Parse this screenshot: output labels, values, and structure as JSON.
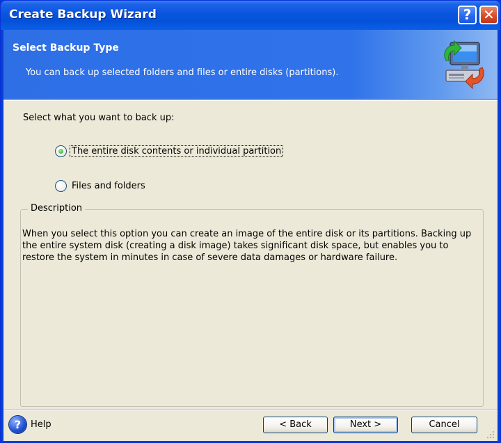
{
  "window": {
    "title": "Create Backup Wizard",
    "help_glyph": "?",
    "close_glyph": "✕"
  },
  "header": {
    "title": "Select Backup Type",
    "subtitle": "You can back up selected folders and files or entire disks (partitions).",
    "icon": "computer-backup-icon"
  },
  "main": {
    "prompt": "Select what you want to back up:",
    "options": [
      {
        "label": "The entire disk contents or individual partition",
        "selected": true
      },
      {
        "label": "Files and folders",
        "selected": false
      }
    ],
    "description": {
      "legend": "Description",
      "text": "When you select this option you can create an image of the entire disk or its partitions. Backing up the entire system disk (creating a disk image) takes significant disk space, but enables you to restore the system in minutes in case of severe data damages or hardware failure."
    }
  },
  "footer": {
    "help_glyph": "?",
    "help_label": "Help",
    "back_label": "< Back",
    "next_label": "Next >",
    "cancel_label": "Cancel"
  },
  "colors": {
    "titlebar": "#0a55e0",
    "header": "#2e6fe6",
    "panel": "#ece9d8",
    "radio_selected": "#22a21a"
  }
}
